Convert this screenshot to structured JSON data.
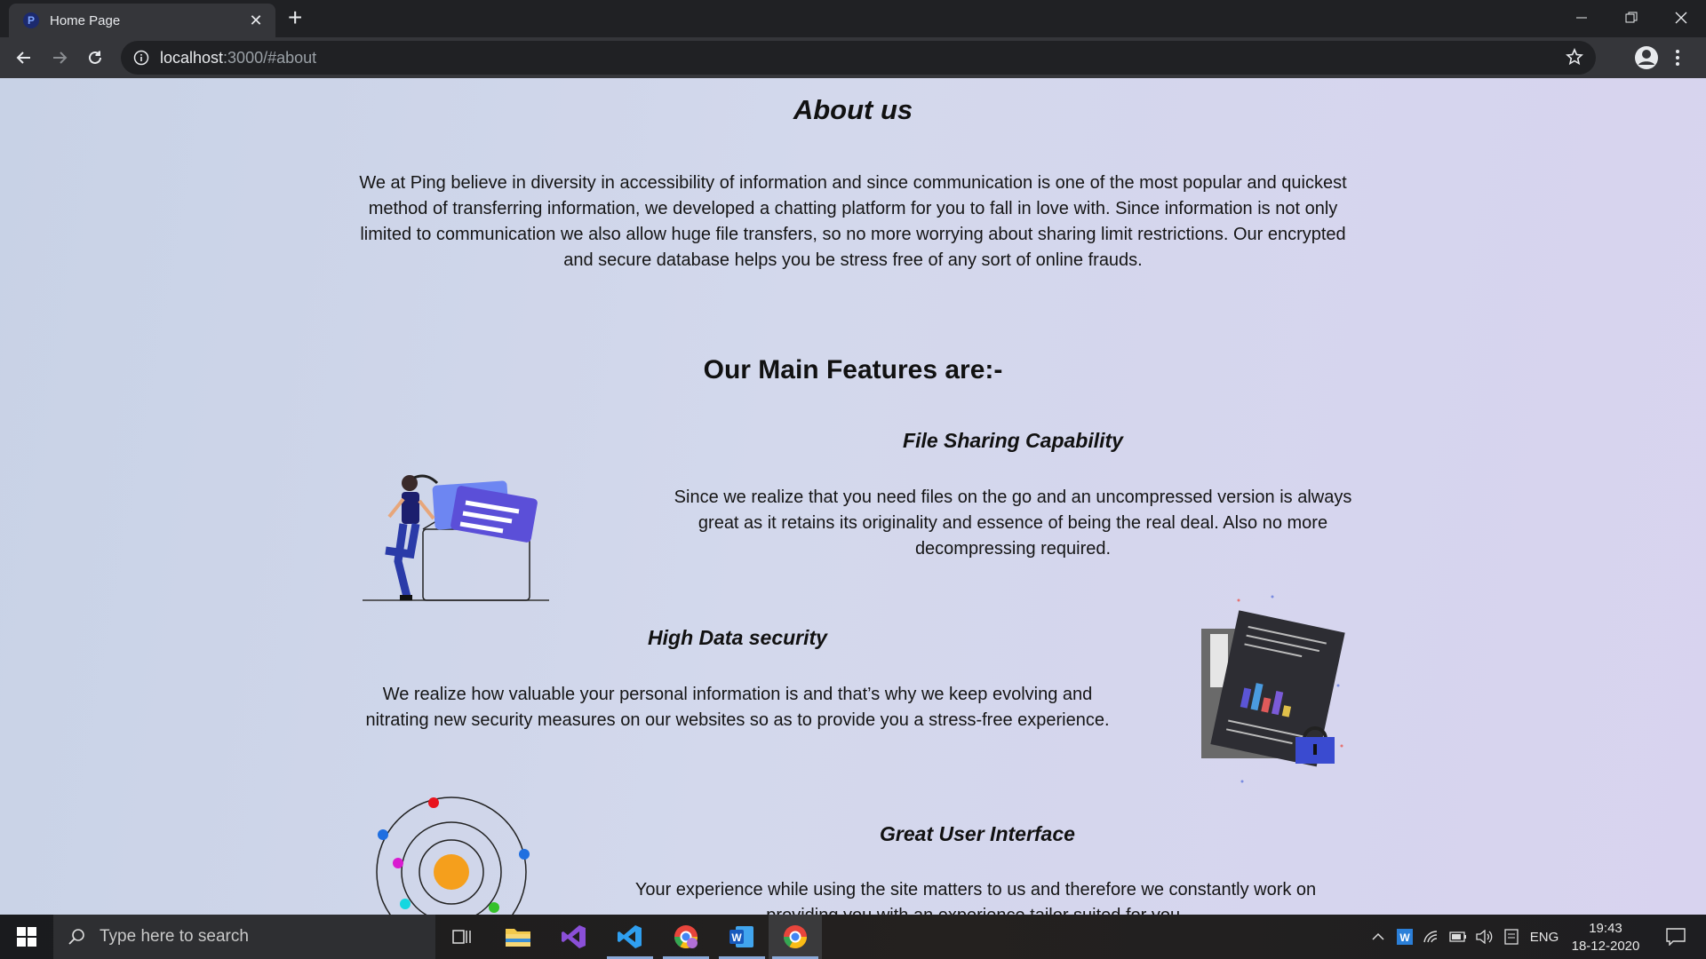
{
  "browser": {
    "tab_title": "Home Page",
    "favicon_letter": "P",
    "url_host": "localhost",
    "url_path": ":3000/#about"
  },
  "about": {
    "title": "About us",
    "text": "We at Ping believe in diversity in accessibility of information and since communication is one of the most popular and quickest method of transferring information, we developed a chatting platform for you to fall in love with. Since information is not only limited to communication we also allow huge file transfers, so no more worrying about sharing limit restrictions. Our encrypted and secure database helps you be stress free of any sort of online frauds."
  },
  "features": {
    "heading": "Our Main Features are:-",
    "items": [
      {
        "title": "File Sharing Capability",
        "text": "Since we realize that you need files on the go and an uncompressed version is always great as it retains its originality and essence of being the real deal. Also no more decompressing required."
      },
      {
        "title": "High Data security",
        "text": "We realize how valuable your personal information is and that’s why we keep evolving and nitrating new security measures on our websites so as to provide you a stress-free experience."
      },
      {
        "title": "Great User Interface",
        "text": "Your experience while using the site matters to us and therefore we constantly work on providing you with an experience tailor suited for you."
      }
    ]
  },
  "taskbar": {
    "search_placeholder": "Type here to search",
    "language": "ENG",
    "time": "19:43",
    "date": "18-12-2020",
    "apps": [
      "task-view",
      "file-explorer",
      "visual-studio",
      "vs-code",
      "chrome-profile",
      "word",
      "chrome"
    ]
  },
  "colors": {
    "chrome_dark": "#202124",
    "chrome_tab": "#35363a",
    "page_bg": "#d3d8ec",
    "accent_purple": "#5b55d6"
  }
}
